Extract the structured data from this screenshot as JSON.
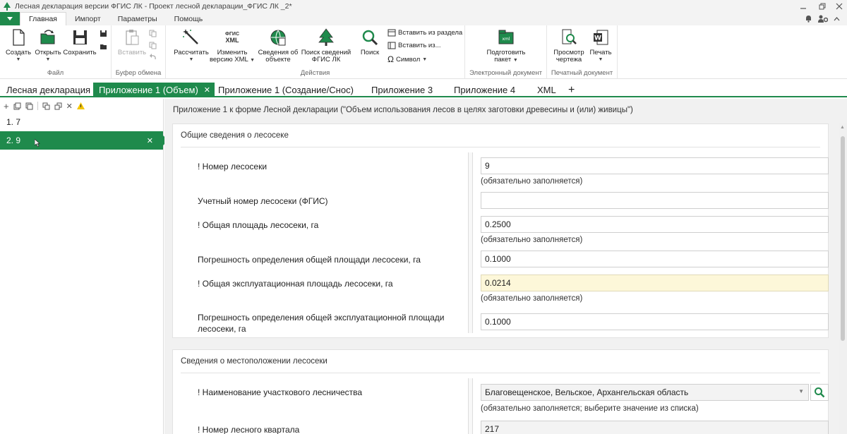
{
  "window": {
    "title": "Лесная декларация версии ФГИС ЛК - Проект лесной декларации_ФГИС ЛК _2*"
  },
  "ribbon_tabs": [
    "Главная",
    "Импорт",
    "Параметры",
    "Помощь"
  ],
  "ribbon": {
    "groups": {
      "file": "Файл",
      "clipboard": "Буфер обмена",
      "actions": "Действия",
      "edoc": "Электронный документ",
      "pdoc": "Печатный документ"
    },
    "buttons": {
      "create": "Создать",
      "open": "Открыть",
      "save": "Сохранить",
      "paste": "Вставить",
      "calculate": "Рассчитать",
      "change_xml_1": "Изменить",
      "change_xml_2": "версию XML",
      "object_info_1": "Сведения об",
      "object_info_2": "объекте",
      "fgis_search_1": "Поиск сведений",
      "fgis_search_2": "ФГИС ЛК",
      "search": "Поиск",
      "paste_from_section": "Вставить из раздела",
      "paste_from": "Вставить из...",
      "symbol": "Символ",
      "prepare_1": "Подготовить",
      "prepare_2": "пакет",
      "preview_1": "Просмотр",
      "preview_2": "чертежа",
      "print": "Печать"
    },
    "icon_text": {
      "fgis_xml_1": "ФГИС",
      "fgis_xml_2": "XML"
    }
  },
  "doc_tabs": [
    "Лесная декларация",
    "Приложение 1 (Объем)",
    "Приложение 1 (Создание/Снос)",
    "Приложение 3",
    "Приложение 4",
    "XML"
  ],
  "left_panel": {
    "items": [
      {
        "num": "1.",
        "value": "7"
      },
      {
        "num": "2.",
        "value": "9"
      }
    ]
  },
  "main": {
    "heading": "Приложение 1 к форме Лесной декларации (\"Объем использования лесов в целях заготовки древесины и (или) живицы\")",
    "section1": {
      "title": "Общие сведения о лесосеке",
      "fields": [
        {
          "label": "! Номер лесосеки",
          "value": "9",
          "hint": "(обязательно заполняется)"
        },
        {
          "label": "Учетный номер лесосеки (ФГИС)",
          "value": ""
        },
        {
          "label": "! Общая площадь лесосеки, га",
          "value": "0.2500",
          "hint": "(обязательно заполняется)"
        },
        {
          "label": "Погрешность определения общей площади лесосеки, га",
          "value": "0.1000"
        },
        {
          "label": "! Общая эксплуатационная площадь лесосеки, га",
          "value": "0.0214",
          "hint": "(обязательно заполняется)"
        },
        {
          "label": "Погрешность определения общей эксплуатационной площади лесосеки, га",
          "value": "0.1000"
        }
      ]
    },
    "section2": {
      "title": "Сведения о местоположении лесосеки",
      "fields": [
        {
          "label": "! Наименование участкового лесничества",
          "value": "Благовещенское, Вельское, Архангельская область",
          "hint": "(обязательно заполняется; выберите значение из списка)"
        },
        {
          "label": "! Номер лесного квартала",
          "value": "217"
        }
      ]
    }
  },
  "colors": {
    "accent": "#1f8a4c",
    "highlight_field": "#fdf7d9"
  }
}
